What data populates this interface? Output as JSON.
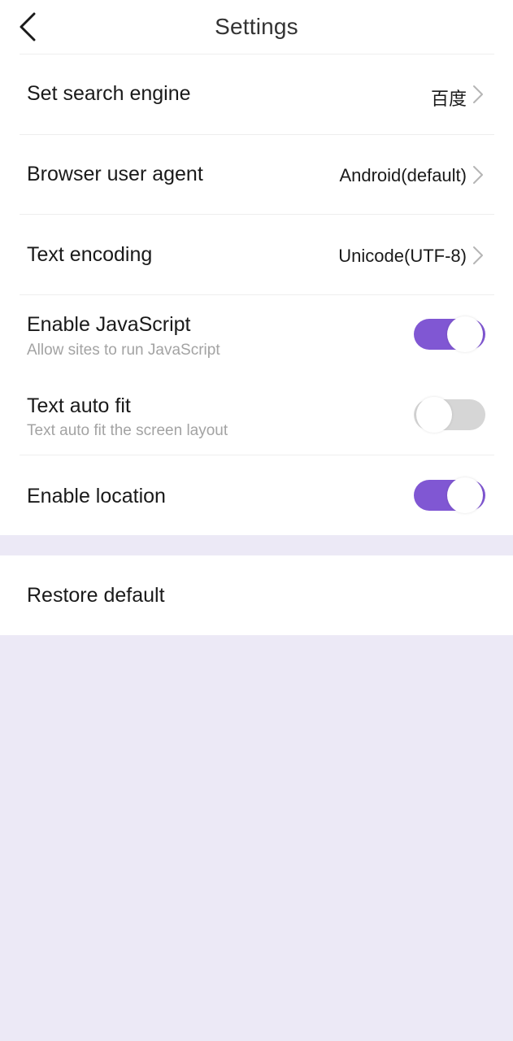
{
  "header": {
    "title": "Settings",
    "back_icon": "chevron-left-icon"
  },
  "settings": {
    "search_engine": {
      "label": "Set search engine",
      "value": "百度"
    },
    "user_agent": {
      "label": "Browser user agent",
      "value": "Android(default)"
    },
    "text_encoding": {
      "label": "Text encoding",
      "value": "Unicode(UTF-8)"
    },
    "javascript": {
      "label": "Enable JavaScript",
      "sublabel": "Allow sites to run JavaScript",
      "enabled": true
    },
    "text_auto_fit": {
      "label": "Text auto fit",
      "sublabel": "Text auto fit the screen layout",
      "enabled": false
    },
    "location": {
      "label": "Enable location",
      "enabled": true
    }
  },
  "restore": {
    "label": "Restore default"
  },
  "colors": {
    "accent": "#8057D3",
    "toggle_off": "#D6D6D6",
    "background": "#ECE9F6",
    "panel": "#FFFFFF",
    "secondary_text": "#A3A3A3"
  }
}
